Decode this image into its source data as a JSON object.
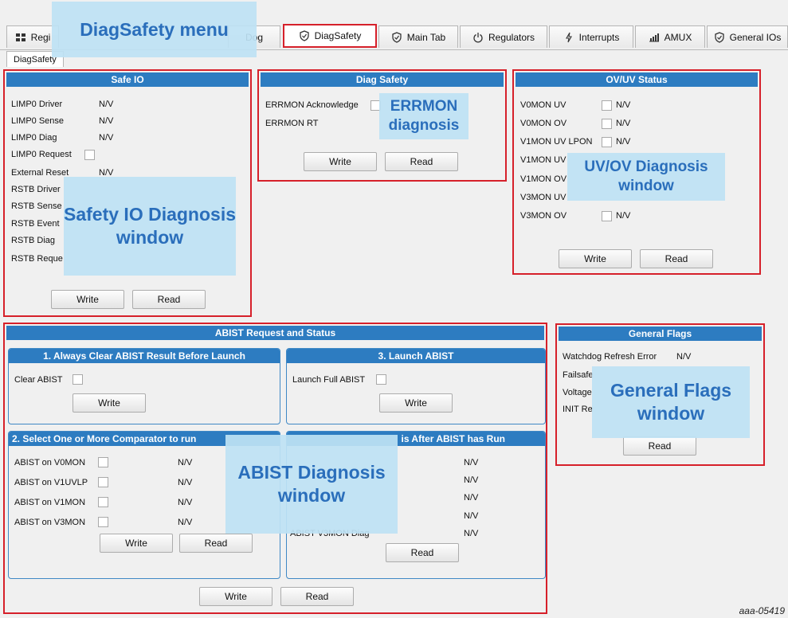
{
  "tabs": [
    {
      "label": "Regi",
      "icon": "register-icon"
    },
    {
      "label": "Dog",
      "icon": "watchdog-icon"
    },
    {
      "label": "DiagSafety",
      "icon": "shield-icon"
    },
    {
      "label": "Main Tab",
      "icon": "shield-icon"
    },
    {
      "label": "Regulators",
      "icon": "power-icon"
    },
    {
      "label": "Interrupts",
      "icon": "lightning-icon"
    },
    {
      "label": "AMUX",
      "icon": "signal-icon"
    },
    {
      "label": "General IOs",
      "icon": "shield-icon"
    }
  ],
  "subtab": "DiagSafety",
  "safe_io": {
    "title": "Safe IO",
    "rows": [
      {
        "label": "LIMP0 Driver",
        "value": "N/V"
      },
      {
        "label": "LIMP0 Sense",
        "value": "N/V"
      },
      {
        "label": "LIMP0 Diag",
        "value": "N/V"
      },
      {
        "label": "LIMP0 Request",
        "value": ""
      },
      {
        "label": "External Reset",
        "value": "N/V"
      },
      {
        "label": "RSTB Driver",
        "value": ""
      },
      {
        "label": "RSTB Sense",
        "value": ""
      },
      {
        "label": "RSTB Event",
        "value": ""
      },
      {
        "label": "RSTB Diag",
        "value": ""
      },
      {
        "label": "RSTB Reque",
        "value": ""
      }
    ],
    "write": "Write",
    "read": "Read"
  },
  "diag_safety": {
    "title": "Diag Safety",
    "rows": [
      {
        "label": "ERRMON Acknowledge"
      },
      {
        "label": "ERRMON RT"
      }
    ],
    "write": "Write",
    "read": "Read"
  },
  "ovuv": {
    "title": "OV/UV Status",
    "rows": [
      {
        "label": "V0MON UV",
        "value": "N/V"
      },
      {
        "label": "V0MON OV",
        "value": "N/V"
      },
      {
        "label": "V1MON UV LPON",
        "value": "N/V"
      },
      {
        "label": "V1MON UV",
        "value": ""
      },
      {
        "label": "V1MON OV",
        "value": ""
      },
      {
        "label": "V3MON UV",
        "value": ""
      },
      {
        "label": "V3MON OV",
        "value": "N/V"
      }
    ],
    "write": "Write",
    "read": "Read"
  },
  "abist": {
    "title": "ABIST Request and Status",
    "clear_section": {
      "title": "1. Always Clear ABIST Result Before Launch",
      "label": "Clear ABIST",
      "write": "Write"
    },
    "launch_section": {
      "title": "3. Launch ABIST",
      "label": "Launch Full ABIST",
      "write": "Write"
    },
    "select_section": {
      "title": "2. Select One or More Comparator to run",
      "rows": [
        {
          "label": "ABIST on V0MON",
          "value": "N/V"
        },
        {
          "label": "ABIST on V1UVLP",
          "value": "N/V"
        },
        {
          "label": "ABIST on V1MON",
          "value": "N/V"
        },
        {
          "label": "ABIST on V3MON",
          "value": "N/V"
        }
      ],
      "write": "Write",
      "read": "Read"
    },
    "status_section": {
      "title": "is After ABIST has Run",
      "values": [
        "N/V",
        "N/V",
        "N/V",
        "N/V",
        "N/V"
      ],
      "last_label": "ABIST V3MON Diag",
      "read": "Read"
    },
    "write": "Write",
    "read": "Read"
  },
  "flags": {
    "title": "General Flags",
    "rows": [
      {
        "label": "Watchdog Refresh Error",
        "value": "N/V"
      },
      {
        "label": "Failsafe",
        "value": ""
      },
      {
        "label": "Voltage",
        "value": ""
      },
      {
        "label": "INIT Re",
        "value": ""
      }
    ],
    "read": "Read"
  },
  "callouts": {
    "menu": "DiagSafety menu",
    "errmon": "ERRMON diagnosis",
    "safety_io": "Safety IO Diagnosis window",
    "uvov": "UV/OV Diagnosis window",
    "flags": "General Flags window",
    "abist": "ABIST Diagnosis window"
  },
  "footer": "aaa-05419"
}
